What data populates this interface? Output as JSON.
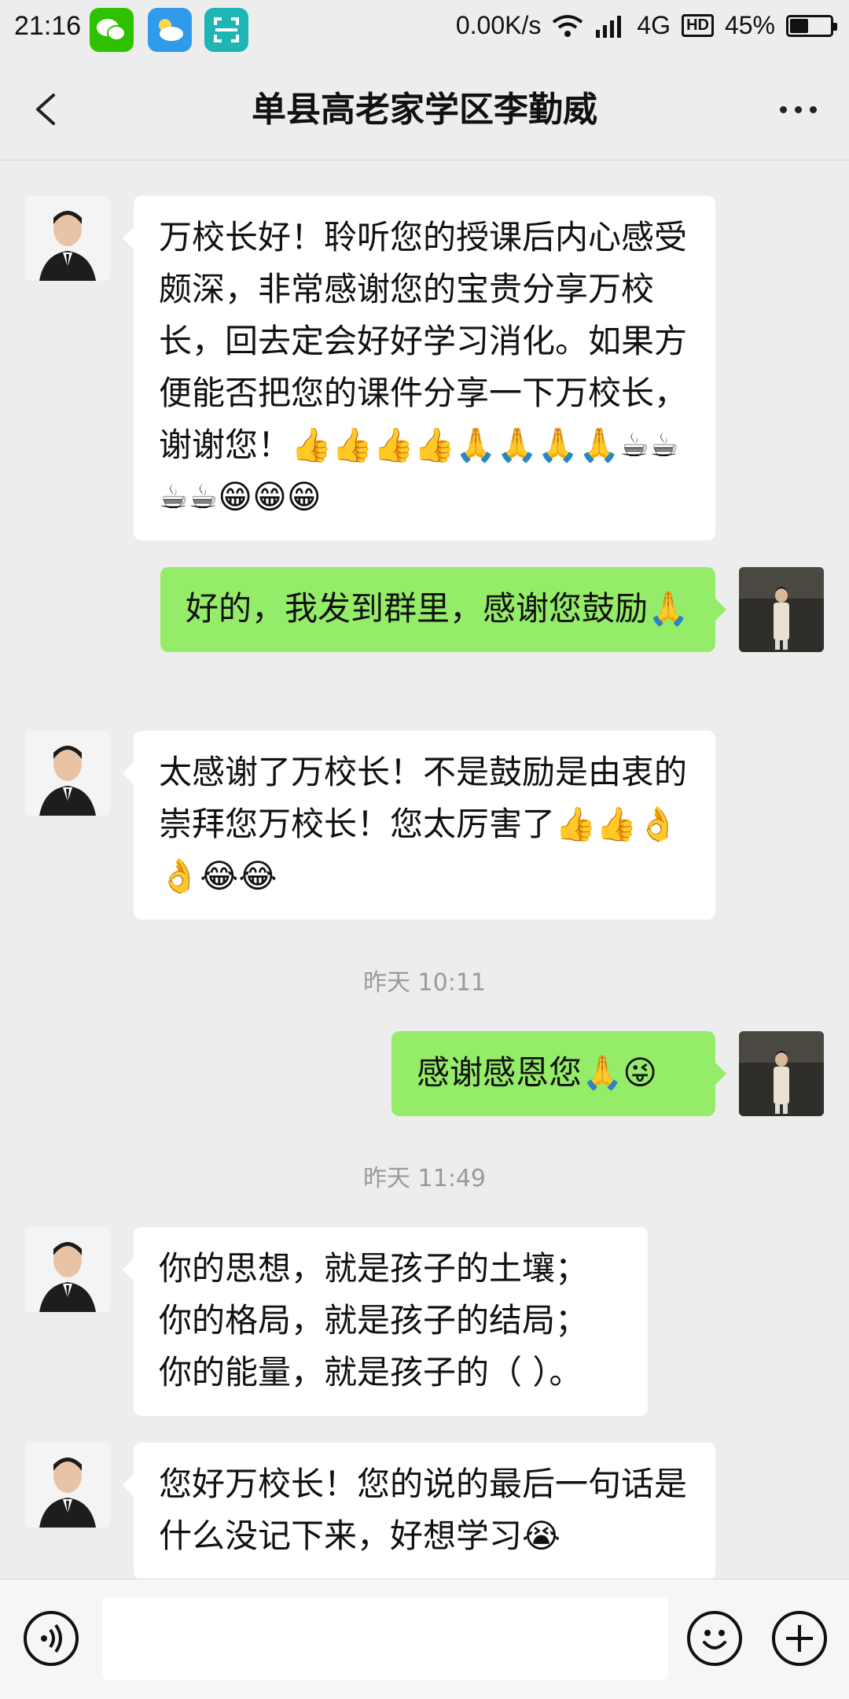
{
  "status_bar": {
    "time": "21:16",
    "network_speed": "0.00K/s",
    "network_type": "4G",
    "hd_badge": "HD",
    "battery": "45%",
    "battery_level": 0.45
  },
  "header": {
    "back_icon": "chevron-left-icon",
    "title": "单县高老家学区李勤威",
    "more_icon": "more-dots-icon"
  },
  "messages": [
    {
      "side": "left",
      "text": "万校长好！聆听您的授课后内心感受颇深，非常感谢您的宝贵分享万校长，回去定会好好学习消化。如果方便能否把您的课件分享一下万校长，谢谢您！👍👍👍👍🙏🙏🙏🙏☕☕☕☕😁😁😁"
    },
    {
      "side": "right",
      "text": "好的，我发到群里，感谢您鼓励🙏"
    },
    {
      "side": "left",
      "text": "太感谢了万校长！不是鼓励是由衷的崇拜您万校长！您太厉害了👍👍👌👌😂😂"
    },
    {
      "side": "right",
      "text": "感谢感恩您🙏😜"
    },
    {
      "side": "left",
      "text": "你的思想，就是孩子的土壤；\n你的格局，就是孩子的结局；\n你的能量，就是孩子的（  ）。"
    },
    {
      "side": "left",
      "text": "您好万校长！您的说的最后一句话是什么没记下来，好想学习😭"
    }
  ],
  "timestamps": [
    "昨天 10:11",
    "昨天 11:49"
  ],
  "input_bar": {
    "voice_icon": "voice-icon",
    "emoji_icon": "emoji-icon",
    "plus_icon": "plus-icon"
  }
}
